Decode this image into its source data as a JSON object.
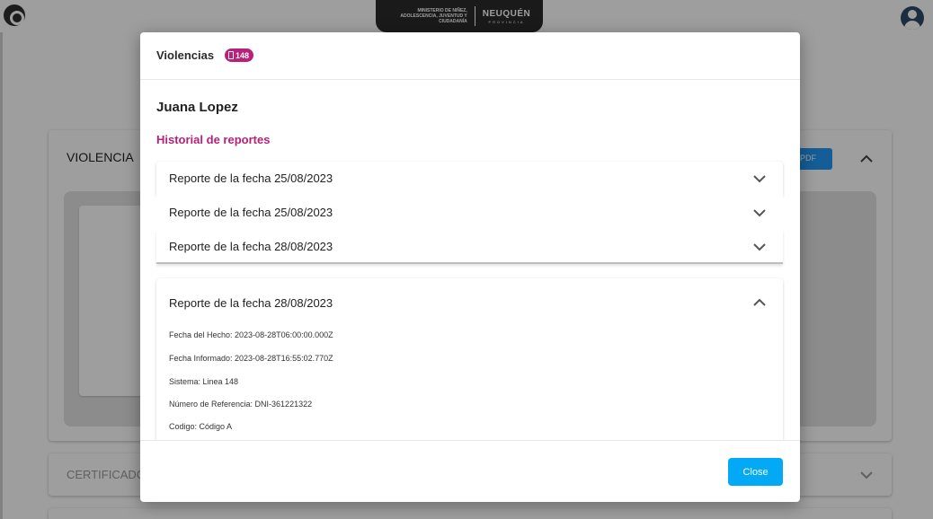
{
  "topbar": {
    "logo_icon": "app-logo-icon",
    "brand_ministry": "MINISTERIO DE NIÑEZ, ADOLESCENCIA, JUVENTUD Y CIUDADANÍA",
    "brand_name": "NEUQUÉN",
    "brand_sub": "PROVINCIA",
    "avatar_icon": "user-avatar-icon"
  },
  "background": {
    "panel_title": "VIOLENCIA",
    "pdf_label": "PDF",
    "panel2_title": "CERTIFICADO"
  },
  "modal": {
    "title": "Violencias",
    "badge": "148",
    "badge_icon": "phone-icon",
    "name": "Juana Lopez",
    "section_title": "Historial de reportes",
    "reports": [
      {
        "label": "Reporte de la fecha 25/08/2023",
        "expanded": false
      },
      {
        "label": "Reporte de la fecha 25/08/2023",
        "expanded": false
      },
      {
        "label": "Reporte de la fecha 28/08/2023",
        "expanded": false
      },
      {
        "label": "Reporte de la fecha 28/08/2023",
        "expanded": true,
        "details": [
          "Fecha del Hecho: 2023-08-28T06:00:00.000Z",
          "Fecha Informado: 2023-08-28T16:55:02.770Z",
          "Sistema: Linea 148",
          "Número de Referencia: DNI-361221322",
          "Codigo: Código A"
        ]
      }
    ],
    "close_label": "Close"
  },
  "colors": {
    "accent": "#b8207a",
    "button": "#03a9f4",
    "pdf_button": "#2196f3",
    "brand_bg": "#2b2b2b"
  }
}
